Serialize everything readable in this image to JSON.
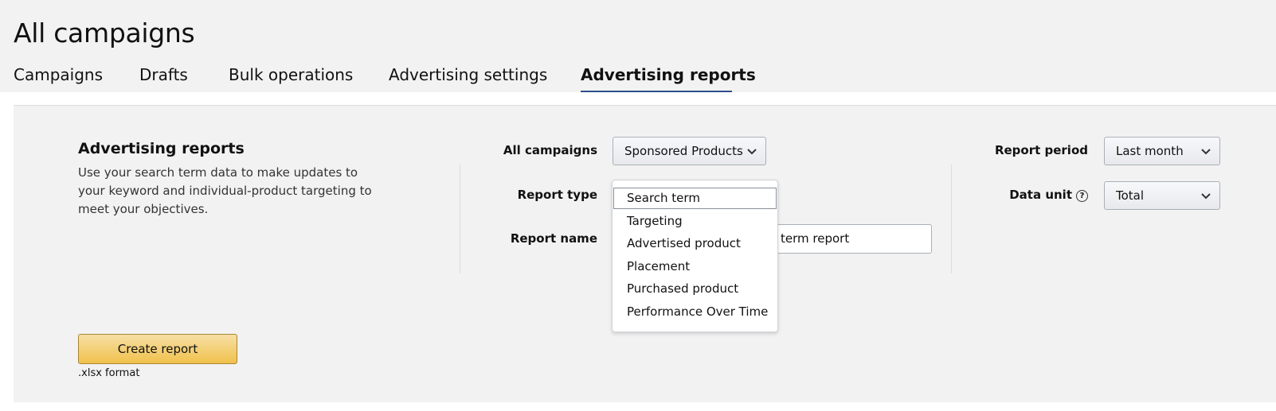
{
  "header": {
    "title": "All campaigns"
  },
  "tabs": [
    {
      "label": "Campaigns",
      "active": false
    },
    {
      "label": "Drafts",
      "active": false
    },
    {
      "label": "Bulk operations",
      "active": false
    },
    {
      "label": "Advertising settings",
      "active": false
    },
    {
      "label": "Advertising reports",
      "active": true
    }
  ],
  "section": {
    "title": "Advertising reports",
    "description": "Use your search term data to make updates to your keyword and individual-product targeting to meet your objectives."
  },
  "form": {
    "campaigns_label": "All campaigns",
    "campaigns_value": "Sponsored Products",
    "report_type_label": "Report type",
    "report_name_label": "Report name",
    "report_name_value": "term report",
    "report_period_label": "Report period",
    "report_period_value": "Last month",
    "data_unit_label": "Data unit",
    "data_unit_value": "Total"
  },
  "report_type_dropdown": {
    "options": [
      "Search term",
      "Targeting",
      "Advertised product",
      "Placement",
      "Purchased product",
      "Performance Over Time"
    ],
    "selected": "Search term"
  },
  "actions": {
    "create_label": "Create report",
    "format_note": ".xlsx format"
  },
  "colors": {
    "active_tab_underline": "#2c4f8c",
    "primary_button": "#f0c14b"
  }
}
